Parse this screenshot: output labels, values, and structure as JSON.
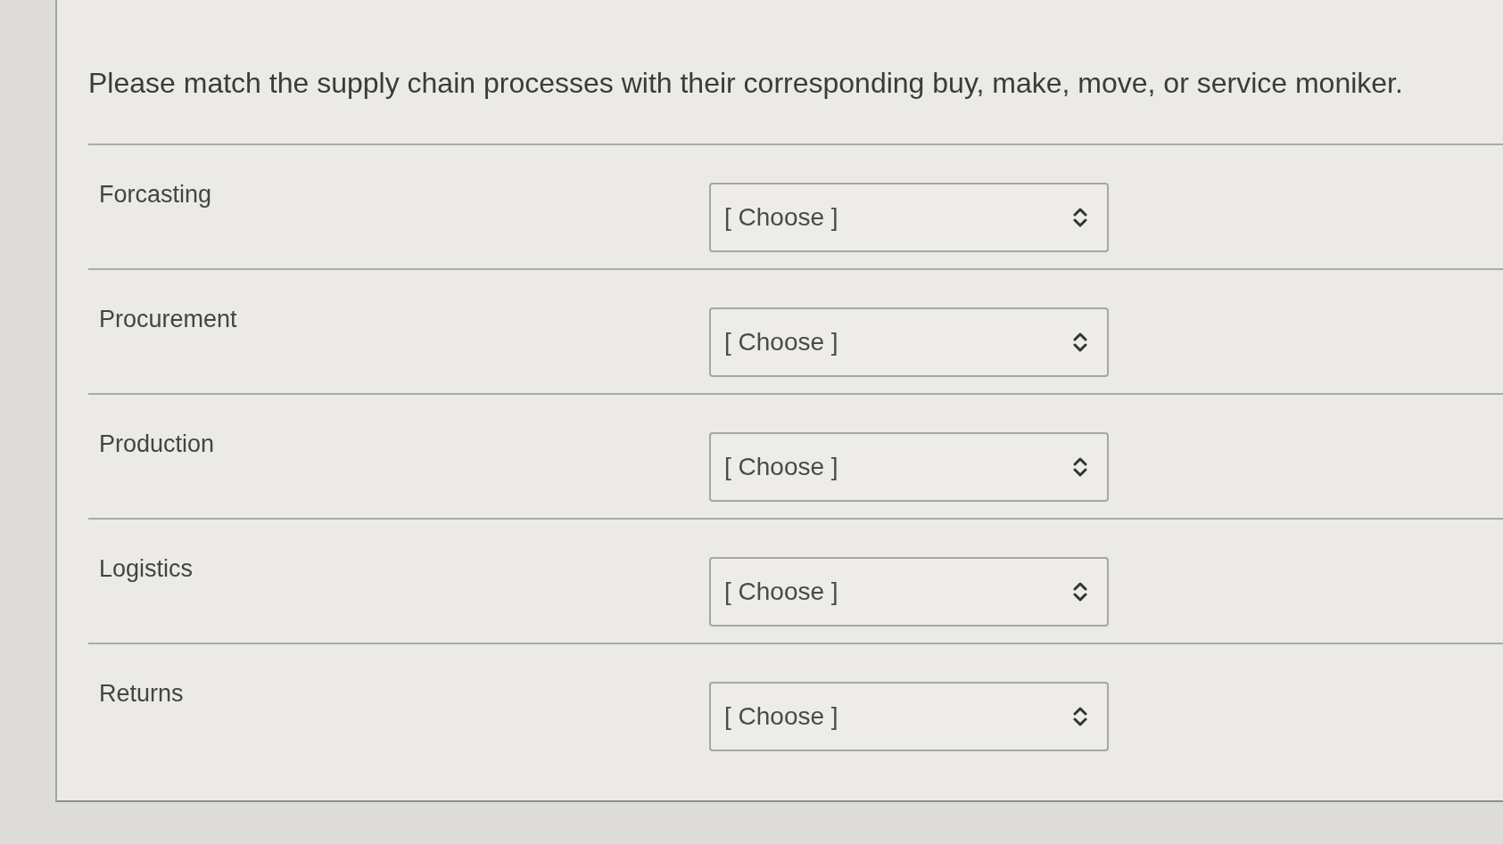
{
  "prompt": "Please match the supply chain processes with their corresponding buy, make, move, or service moniker.",
  "rows": [
    {
      "process": "Forcasting",
      "answer": "[ Choose ]"
    },
    {
      "process": "Procurement",
      "answer": "[ Choose ]"
    },
    {
      "process": "Production",
      "answer": "[ Choose ]"
    },
    {
      "process": "Logistics",
      "answer": "[ Choose ]"
    },
    {
      "process": "Returns",
      "answer": "[ Choose ]"
    }
  ]
}
